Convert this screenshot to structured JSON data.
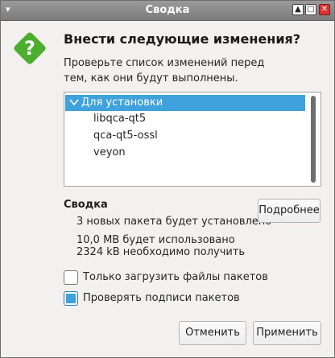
{
  "window": {
    "title": "Сводка"
  },
  "header": {
    "heading": "Внести следующие изменения?",
    "description_line1": "Проверьте список изменений перед",
    "description_line2": "тем, как они будут выполнены."
  },
  "changes": {
    "group_label": "Для установки",
    "items": [
      "libqca-qt5",
      "qca-qt5-ossl",
      "veyon"
    ]
  },
  "summary": {
    "title": "Сводка",
    "packages_line": "3 новых пакета будет установлено",
    "space_line": "10,0 MB будет использовано",
    "download_line": "2324 kB необходимо получить",
    "details_button": "Подробнее"
  },
  "options": {
    "download_only": {
      "label": "Только загрузить файлы пакетов",
      "checked": false
    },
    "verify_signatures": {
      "label": "Проверять подписи пакетов",
      "checked": true
    }
  },
  "buttons": {
    "cancel": "Отменить",
    "apply": "Применить"
  },
  "colors": {
    "accent": "#3fa2dd",
    "icon_green": "#4bae2c",
    "titlebar": "#8a8a8a",
    "close": "#dd3333"
  }
}
